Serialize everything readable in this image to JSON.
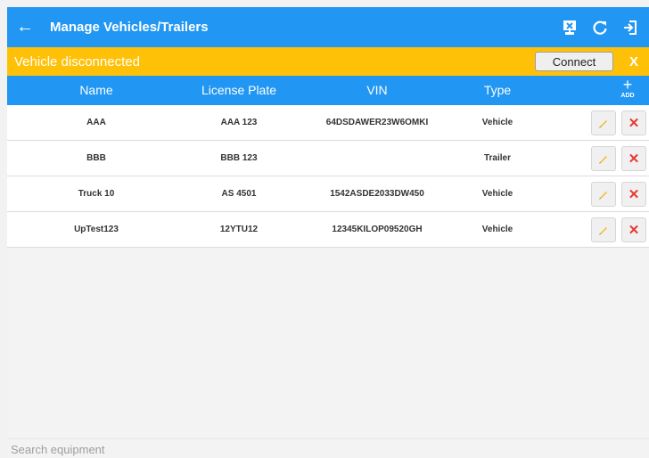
{
  "appbar": {
    "title": "Manage Vehicles/Trailers",
    "back_icon": "back-arrow-icon",
    "actions": [
      "device-icon",
      "refresh-icon",
      "logout-icon"
    ]
  },
  "banner": {
    "text": "Vehicle disconnected",
    "connect_label": "Connect",
    "close_label": "X"
  },
  "table": {
    "columns": [
      "Name",
      "License Plate",
      "VIN",
      "Type"
    ],
    "add_label": "ADD",
    "rows": [
      {
        "name": "AAA",
        "plate": "AAA 123",
        "vin": "64DSDAWER23W6OMKI",
        "type": "Vehicle"
      },
      {
        "name": "BBB",
        "plate": "BBB 123",
        "vin": "",
        "type": "Trailer"
      },
      {
        "name": "Truck 10",
        "plate": "AS 4501",
        "vin": "1542ASDE2033DW450",
        "type": "Vehicle"
      },
      {
        "name": "UpTest123",
        "plate": "12YTU12",
        "vin": "12345KILOP09520GH",
        "type": "Vehicle"
      }
    ]
  },
  "search": {
    "placeholder": "Search equipment",
    "value": ""
  },
  "colors": {
    "primary": "#2196f3",
    "warning": "#ffc107",
    "delete": "#e53935",
    "edit": "#f6b81f"
  }
}
